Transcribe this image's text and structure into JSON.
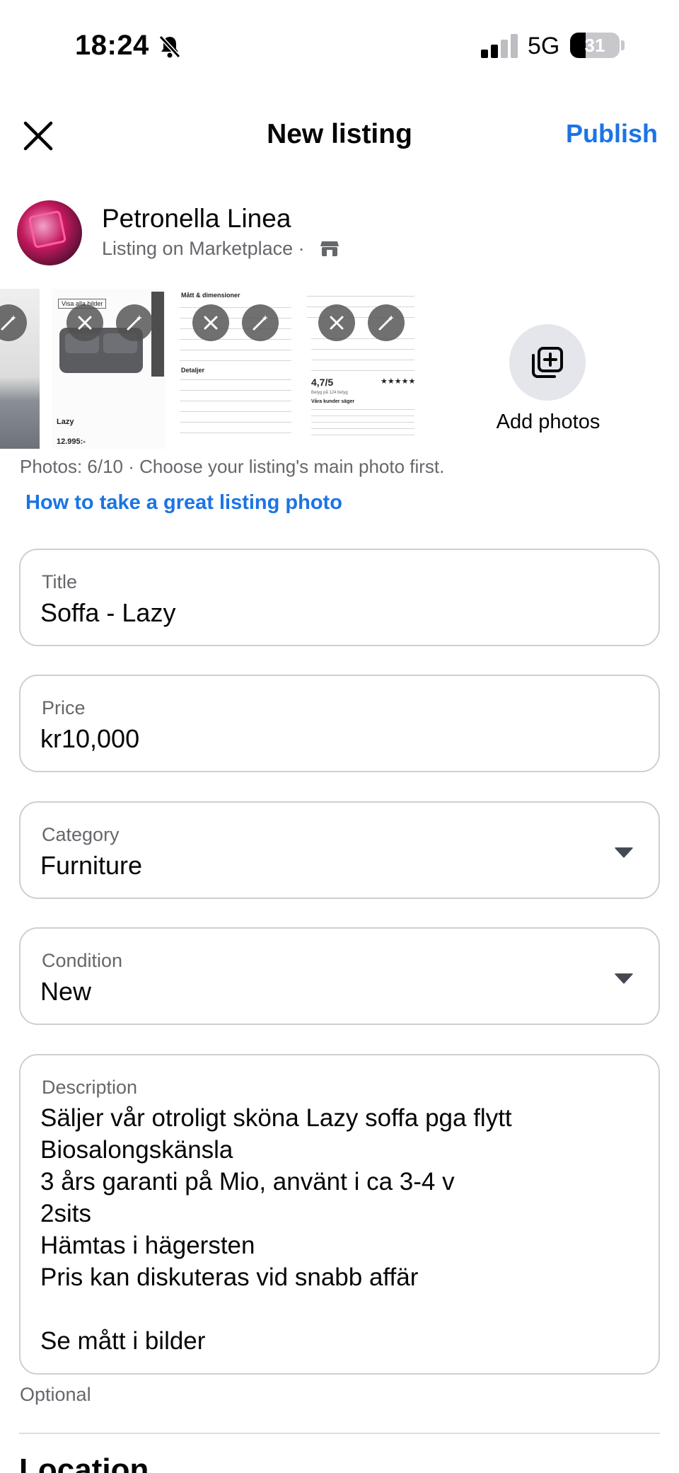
{
  "status_bar": {
    "time": "18:24",
    "network": "5G",
    "battery": "31"
  },
  "header": {
    "title": "New listing",
    "publish_label": "Publish"
  },
  "profile": {
    "name": "Petronella Linea",
    "subtitle": "Listing on Marketplace ·"
  },
  "photos": {
    "thumb_texts": {
      "product_name": "Lazy",
      "product_price": "12.995:-",
      "rating": "4,7/5",
      "stars": "★★★★★",
      "spec_heading": "Mått & dimensioner",
      "details_heading": "Detaljer",
      "view_all": "Visa alla bilder",
      "rating_sub": "Betyg på 124 betyg",
      "reviews_heading": "Våra kunder säger"
    },
    "add_label": "Add photos",
    "count_text": "Photos: 6/10 · Choose your listing's main photo first.",
    "howto_link": "How to take a great listing photo"
  },
  "fields": {
    "title": {
      "label": "Title",
      "value": "Soffa - Lazy"
    },
    "price": {
      "label": "Price",
      "value": "kr10,000"
    },
    "category": {
      "label": "Category",
      "value": "Furniture"
    },
    "condition": {
      "label": "Condition",
      "value": "New"
    },
    "description": {
      "label": "Description",
      "value": "Säljer vår otroligt sköna Lazy soffa pga flytt\nBiosalongskänsla\n3 års garanti på Mio, använt i ca 3-4 v\n2sits\nHämtas i hägersten\nPris kan diskuteras vid snabb affär\n\nSe mått i bilder"
    },
    "optional_hint": "Optional"
  },
  "location": {
    "heading": "Location"
  },
  "colors": {
    "accent": "#1b74e4",
    "secondary_text": "#65676b",
    "field_border": "#ccd0d5"
  },
  "icons": [
    "bell-slash-icon",
    "close-icon",
    "shop-icon",
    "magic-wand-icon",
    "remove-photo-icon",
    "add-photo-icon",
    "chevron-down-icon"
  ]
}
